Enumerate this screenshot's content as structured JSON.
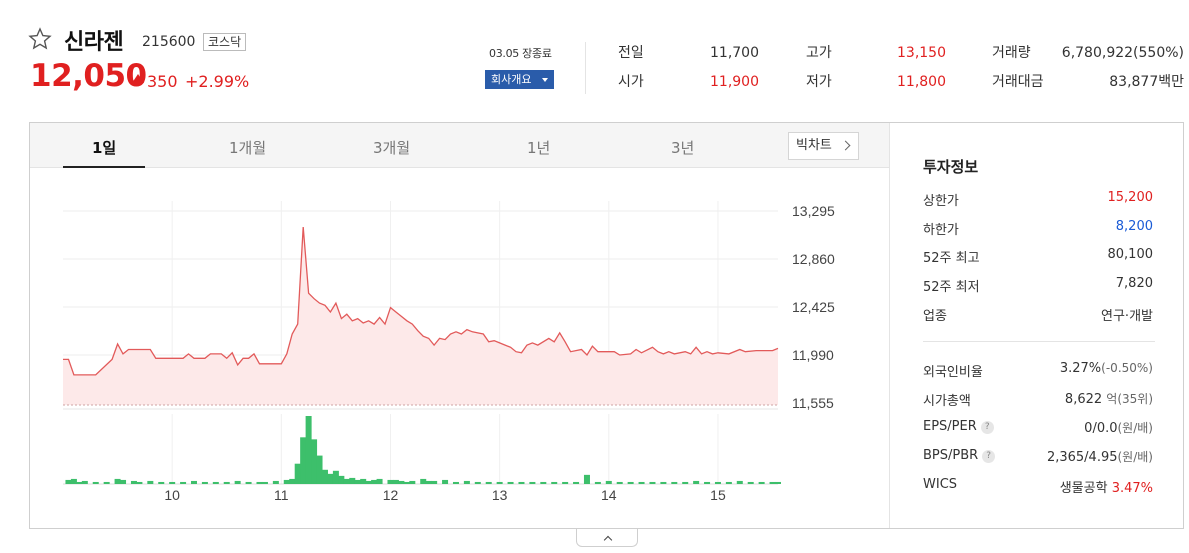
{
  "stock": {
    "name": "신라젠",
    "code": "215600",
    "market": "코스닥",
    "price": "12,050",
    "change": "350",
    "change_pct": "+2.99%",
    "close_note": "03.05 장종료",
    "company_button": "회사개요"
  },
  "summary": {
    "prev_close": {
      "label": "전일",
      "value": "11,700"
    },
    "open": {
      "label": "시가",
      "value": "11,900"
    },
    "high": {
      "label": "고가",
      "value": "13,150"
    },
    "low": {
      "label": "저가",
      "value": "11,800"
    },
    "volume": {
      "label": "거래량",
      "value": "6,780,922(550%)"
    },
    "amount": {
      "label": "거래대금",
      "value": "83,877백만"
    }
  },
  "tabs": [
    "1일",
    "1개월",
    "3개월",
    "1년",
    "3년"
  ],
  "active_tab": 0,
  "bigchart_label": "빅차트",
  "chart_data": {
    "type": "line",
    "title": "",
    "x_ticks": [
      "10",
      "11",
      "12",
      "13",
      "14",
      "15"
    ],
    "y_ticks": [
      "13,295",
      "12,860",
      "12,425",
      "11,990",
      "11,555"
    ],
    "y_tick_values": [
      13295,
      12860,
      12425,
      11990,
      11555
    ],
    "ylim": [
      11555,
      13295
    ],
    "prev_close": 11700,
    "line_color": "#e25a5a",
    "fill_color": "#fde9e9",
    "grid": true,
    "price_series": [
      [
        9.0,
        11950
      ],
      [
        9.05,
        11950
      ],
      [
        9.1,
        11810
      ],
      [
        9.15,
        11810
      ],
      [
        9.3,
        11810
      ],
      [
        9.45,
        11950
      ],
      [
        9.5,
        12090
      ],
      [
        9.55,
        12000
      ],
      [
        9.6,
        12040
      ],
      [
        9.7,
        12040
      ],
      [
        9.8,
        12040
      ],
      [
        9.85,
        11960
      ],
      [
        9.95,
        11960
      ],
      [
        10.0,
        11960
      ],
      [
        10.1,
        11960
      ],
      [
        10.15,
        12000
      ],
      [
        10.2,
        11960
      ],
      [
        10.3,
        11960
      ],
      [
        10.35,
        12000
      ],
      [
        10.45,
        12000
      ],
      [
        10.5,
        11960
      ],
      [
        10.55,
        12010
      ],
      [
        10.6,
        11900
      ],
      [
        10.65,
        11960
      ],
      [
        10.7,
        11960
      ],
      [
        10.75,
        12000
      ],
      [
        10.8,
        11910
      ],
      [
        10.85,
        11910
      ],
      [
        10.95,
        11910
      ],
      [
        11.0,
        11910
      ],
      [
        11.05,
        12000
      ],
      [
        11.1,
        12180
      ],
      [
        11.15,
        12270
      ],
      [
        11.2,
        13150
      ],
      [
        11.25,
        12550
      ],
      [
        11.3,
        12500
      ],
      [
        11.35,
        12460
      ],
      [
        11.4,
        12440
      ],
      [
        11.45,
        12380
      ],
      [
        11.5,
        12460
      ],
      [
        11.55,
        12320
      ],
      [
        11.6,
        12360
      ],
      [
        11.65,
        12300
      ],
      [
        11.7,
        12320
      ],
      [
        11.75,
        12280
      ],
      [
        11.8,
        12300
      ],
      [
        11.85,
        12270
      ],
      [
        11.9,
        12330
      ],
      [
        11.95,
        12270
      ],
      [
        12.0,
        12420
      ],
      [
        12.05,
        12380
      ],
      [
        12.1,
        12340
      ],
      [
        12.15,
        12300
      ],
      [
        12.2,
        12270
      ],
      [
        12.25,
        12210
      ],
      [
        12.3,
        12160
      ],
      [
        12.35,
        12140
      ],
      [
        12.4,
        12080
      ],
      [
        12.45,
        12140
      ],
      [
        12.5,
        12130
      ],
      [
        12.55,
        12180
      ],
      [
        12.6,
        12200
      ],
      [
        12.65,
        12180
      ],
      [
        12.7,
        12220
      ],
      [
        12.75,
        12200
      ],
      [
        12.8,
        12190
      ],
      [
        12.85,
        12180
      ],
      [
        12.9,
        12110
      ],
      [
        12.95,
        12120
      ],
      [
        13.0,
        12100
      ],
      [
        13.05,
        12080
      ],
      [
        13.1,
        12060
      ],
      [
        13.15,
        12020
      ],
      [
        13.2,
        12010
      ],
      [
        13.25,
        12080
      ],
      [
        13.3,
        12100
      ],
      [
        13.35,
        12080
      ],
      [
        13.45,
        12140
      ],
      [
        13.5,
        12110
      ],
      [
        13.55,
        12190
      ],
      [
        13.6,
        12110
      ],
      [
        13.65,
        12020
      ],
      [
        13.75,
        12040
      ],
      [
        13.8,
        11990
      ],
      [
        13.85,
        12070
      ],
      [
        13.9,
        12020
      ],
      [
        14.0,
        12020
      ],
      [
        14.05,
        12020
      ],
      [
        14.1,
        11990
      ],
      [
        14.2,
        12000
      ],
      [
        14.25,
        12040
      ],
      [
        14.3,
        12010
      ],
      [
        14.4,
        12060
      ],
      [
        14.45,
        12020
      ],
      [
        14.5,
        12000
      ],
      [
        14.55,
        12020
      ],
      [
        14.6,
        12000
      ],
      [
        14.7,
        12020
      ],
      [
        14.75,
        12000
      ],
      [
        14.8,
        12060
      ],
      [
        14.85,
        12000
      ],
      [
        14.9,
        12020
      ],
      [
        14.95,
        12000
      ],
      [
        15.0,
        12010
      ],
      [
        15.1,
        12000
      ],
      [
        15.2,
        12040
      ],
      [
        15.25,
        12020
      ],
      [
        15.35,
        12030
      ],
      [
        15.5,
        12030
      ],
      [
        15.55,
        12050
      ]
    ],
    "volume_series": [
      [
        9.05,
        4
      ],
      [
        9.1,
        5
      ],
      [
        9.15,
        2
      ],
      [
        9.2,
        3
      ],
      [
        9.3,
        2
      ],
      [
        9.4,
        2
      ],
      [
        9.5,
        5
      ],
      [
        9.55,
        4
      ],
      [
        9.65,
        3
      ],
      [
        9.7,
        2
      ],
      [
        9.8,
        3
      ],
      [
        9.9,
        2
      ],
      [
        10.0,
        2
      ],
      [
        10.1,
        2
      ],
      [
        10.2,
        3
      ],
      [
        10.3,
        2
      ],
      [
        10.4,
        2
      ],
      [
        10.5,
        2
      ],
      [
        10.6,
        3
      ],
      [
        10.7,
        2
      ],
      [
        10.8,
        2
      ],
      [
        10.85,
        2
      ],
      [
        10.95,
        3
      ],
      [
        11.05,
        4
      ],
      [
        11.1,
        5
      ],
      [
        11.15,
        20
      ],
      [
        11.2,
        46
      ],
      [
        11.25,
        67
      ],
      [
        11.3,
        44
      ],
      [
        11.35,
        28
      ],
      [
        11.4,
        14
      ],
      [
        11.45,
        10
      ],
      [
        11.5,
        13
      ],
      [
        11.55,
        8
      ],
      [
        11.6,
        5
      ],
      [
        11.65,
        6
      ],
      [
        11.7,
        4
      ],
      [
        11.75,
        5
      ],
      [
        11.8,
        3
      ],
      [
        11.85,
        4
      ],
      [
        11.9,
        5
      ],
      [
        12.0,
        4
      ],
      [
        12.05,
        4
      ],
      [
        12.1,
        3
      ],
      [
        12.15,
        2
      ],
      [
        12.2,
        3
      ],
      [
        12.3,
        5
      ],
      [
        12.35,
        3
      ],
      [
        12.4,
        3
      ],
      [
        12.5,
        4
      ],
      [
        12.6,
        2
      ],
      [
        12.7,
        3
      ],
      [
        12.8,
        2
      ],
      [
        12.9,
        2
      ],
      [
        13.0,
        2
      ],
      [
        13.1,
        2
      ],
      [
        13.2,
        2
      ],
      [
        13.3,
        2
      ],
      [
        13.4,
        2
      ],
      [
        13.5,
        2
      ],
      [
        13.6,
        2
      ],
      [
        13.7,
        2
      ],
      [
        13.8,
        9
      ],
      [
        13.9,
        2
      ],
      [
        14.0,
        3
      ],
      [
        14.1,
        2
      ],
      [
        14.2,
        2
      ],
      [
        14.3,
        2
      ],
      [
        14.4,
        2
      ],
      [
        14.5,
        2
      ],
      [
        14.6,
        2
      ],
      [
        14.7,
        2
      ],
      [
        14.8,
        3
      ],
      [
        14.9,
        2
      ],
      [
        15.0,
        2
      ],
      [
        15.1,
        2
      ],
      [
        15.2,
        3
      ],
      [
        15.3,
        2
      ],
      [
        15.4,
        2
      ],
      [
        15.5,
        2
      ],
      [
        15.55,
        2
      ]
    ]
  },
  "invest": {
    "title": "투자정보",
    "rows1": [
      {
        "label": "상한가",
        "value": "15,200",
        "color": "red"
      },
      {
        "label": "하한가",
        "value": "8,200",
        "color": "blue"
      },
      {
        "label": "52주 최고",
        "value": "80,100",
        "color": "dark"
      },
      {
        "label": "52주 최저",
        "value": "7,820",
        "color": "dark"
      },
      {
        "label": "업종",
        "value": "연구·개발",
        "color": "dark"
      }
    ],
    "foreign_ratio": {
      "label": "외국인비율",
      "value": "3.27%",
      "sub": "(-0.50%)"
    },
    "market_cap": {
      "label": "시가총액",
      "value": "8,622",
      "sub": "억(35위)"
    },
    "eps_per": {
      "label": "EPS/PER",
      "q": "?",
      "value": "0/0.0",
      "sub": "(원/배)"
    },
    "bps_pbr": {
      "label": "BPS/PBR",
      "q": "?",
      "value": "2,365/4.95",
      "sub": "(원/배)"
    },
    "wics": {
      "label": "WICS",
      "value": "생물공학",
      "pct": "3.47%"
    }
  }
}
